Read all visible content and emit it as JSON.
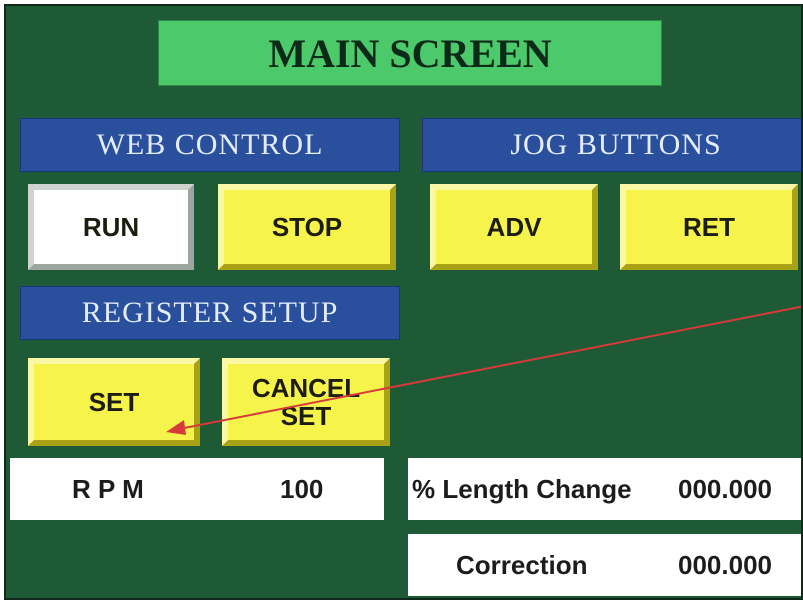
{
  "title": "MAIN SCREEN",
  "sections": {
    "web_control": "WEB CONTROL",
    "jog_buttons": "JOG BUTTONS",
    "register_setup": "REGISTER SETUP"
  },
  "buttons": {
    "run": "RUN",
    "stop": "STOP",
    "adv": "ADV",
    "ret": "RET",
    "set": "SET",
    "cancel_set_line1": "CANCEL",
    "cancel_set_line2": "SET"
  },
  "readouts": {
    "rpm_label": "R P M",
    "rpm_value": "100",
    "length_change_label": "% Length Change",
    "length_change_value": "000.000",
    "correction_label": "Correction",
    "correction_value": "000.000"
  },
  "colors": {
    "background": "#1e5a36",
    "title_bar": "#4cc96a",
    "section_header": "#2a4f9d",
    "button": "#f6f34a",
    "active_button": "#ffffff",
    "annotation_arrow": "#d63a3a"
  },
  "state": {
    "active_button": "run"
  }
}
